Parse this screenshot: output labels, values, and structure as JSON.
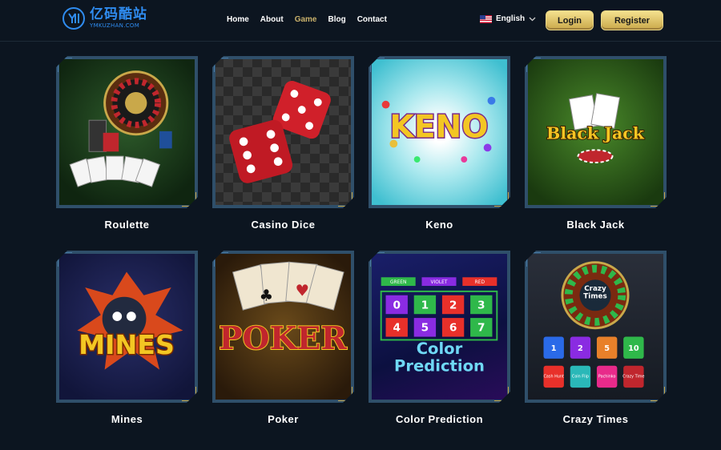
{
  "brand": {
    "name_cn": "亿码酷站",
    "name_en": "YMKUZHAN.COM",
    "color": "#2f8cf0",
    "icon": "logo-mark-icon"
  },
  "nav": {
    "items": [
      {
        "label": "Home",
        "active": false
      },
      {
        "label": "About",
        "active": false
      },
      {
        "label": "Game",
        "active": true
      },
      {
        "label": "Blog",
        "active": false
      },
      {
        "label": "Contact",
        "active": false
      }
    ]
  },
  "language": {
    "label": "English",
    "flag": "us-flag-icon"
  },
  "auth": {
    "login_label": "Login",
    "register_label": "Register"
  },
  "games": [
    {
      "label": "Roulette",
      "art_text": ""
    },
    {
      "label": "Casino Dice",
      "art_text": ""
    },
    {
      "label": "Keno",
      "art_text": "KENO"
    },
    {
      "label": "Black Jack",
      "art_text": "Black Jack"
    },
    {
      "label": "Mines",
      "art_text": "MINES"
    },
    {
      "label": "Poker",
      "art_text": "POKER"
    },
    {
      "label": "Color Prediction",
      "art_text": "Color Prediction",
      "art_tabs": [
        "GREEN",
        "VIOLET",
        "RED"
      ],
      "art_numbers": [
        "0",
        "1",
        "2",
        "3",
        "4",
        "5",
        "6",
        "7"
      ]
    },
    {
      "label": "Crazy Times",
      "art_text": "Crazy Times",
      "art_numbers": [
        "1",
        "2",
        "5",
        "10"
      ],
      "art_bonus": [
        "Cash Hunt",
        "Coin Flip",
        "Pachinko",
        "Crazy Time"
      ]
    }
  ],
  "colors": {
    "background": "#0c1520",
    "accent_gold": "#c9a84a",
    "active_nav": "#c9b16b"
  }
}
